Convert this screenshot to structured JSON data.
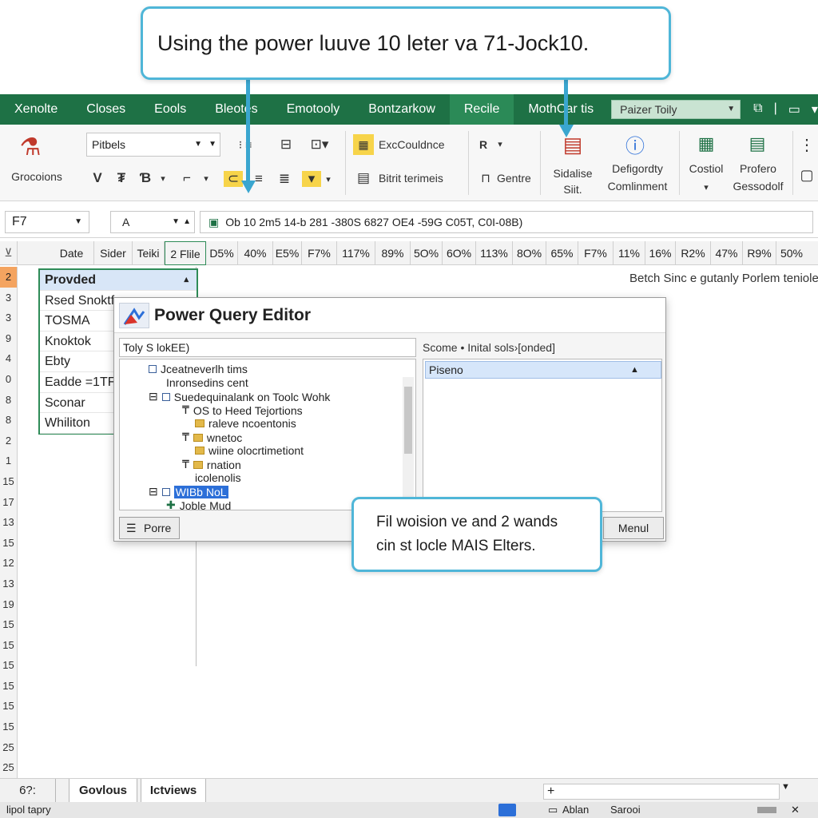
{
  "callout_top": {
    "text": "Using the power luuve 10 leter va 71-Jock10."
  },
  "tabs": [
    {
      "label": "Xenolte"
    },
    {
      "label": "Closes"
    },
    {
      "label": "Eools"
    },
    {
      "label": "Bleotes"
    },
    {
      "label": "Emotooly"
    },
    {
      "label": "Bontzarkow"
    },
    {
      "label": "Recile"
    },
    {
      "label": "MothCar tis"
    }
  ],
  "tab_search": {
    "value": "Paizer Toily"
  },
  "ribbon": {
    "clipboard_label": "Grocoions",
    "font_name": "Pitbels",
    "format_symbols": [
      "V",
      "₮",
      "Ɓ",
      "⌐",
      "⊂",
      "≡",
      "≣",
      "▾"
    ],
    "styles_top": "ExcCouldnce",
    "styles_bottom": "Bitrit terimeis",
    "cells_top": "R",
    "cells_bottom": "Gentre",
    "sidalise_label_1": "Sidalise",
    "sidalise_label_2": "Siit.",
    "defig_label_1": "Defigordty",
    "defig_label_2": "Comlinment",
    "costiol_label": "Costiol",
    "profero_label_1": "Profero",
    "profero_label_2": "Gessodolf"
  },
  "formula_bar": {
    "name_box": "F7",
    "fx": "A",
    "formula": "Ob 10 2m5 14-b 281 -380S 6827 OE4 -59G C05T, C0I-08B)"
  },
  "column_headers": [
    "Date",
    "Sider",
    "Teiki",
    "2 Flile",
    "D5%",
    "40%",
    "E5%",
    "F7%",
    "117%",
    "89%",
    "5O%",
    "6O%",
    "113%",
    "8O%",
    "65%",
    "F7%",
    "11%",
    "16%",
    "R2%",
    "47%",
    "R9%",
    "50%"
  ],
  "row_headers": [
    "2",
    "3",
    "3",
    "9",
    "4",
    "0",
    "8",
    "8",
    "2",
    "1",
    "15",
    "17",
    "13",
    "15",
    "12",
    "13",
    "19",
    "15",
    "15",
    "15",
    "15",
    "15",
    "15",
    "25",
    "25"
  ],
  "sheet_list": {
    "header": "Provded",
    "items": [
      "Rsed Snoktf",
      "TOSMA",
      "Knoktok",
      "Ebty",
      "Eadde =1TFI",
      "Sconar",
      "Whiliton"
    ]
  },
  "side_note": "Betch Sinc e gutanly Porlem teniole",
  "dialog": {
    "title": "Power Query Editor",
    "left_input": "Toly S lokEE)",
    "right_label": "Scome • Inital sols›[onded]",
    "right_selected": "Piseno",
    "tree": [
      "Jceatneverlh tims",
      "Inronsedins cent",
      "Suedequinalank on Toolc Wohk",
      "OS to Heed Tejortions",
      "raleve ncoentonis",
      "wnetoc",
      "wiine olocrtimetiont",
      "rnation",
      "icolenolis",
      "WIBb NoL",
      "Joble Mud"
    ],
    "bottom_button": "Porre",
    "menu_button": "Menul"
  },
  "callout_low": {
    "line1": "Fil woision ve and 2 wands",
    "line2": "cin st locle MAIS Elters."
  },
  "sheets": {
    "nav": "6?:",
    "tabs": [
      "Govlous",
      "Ictviews"
    ],
    "add_field": "+"
  },
  "status": {
    "left": "lipol tapry",
    "right_1": "Ablan",
    "right_2": "Sarooi"
  }
}
